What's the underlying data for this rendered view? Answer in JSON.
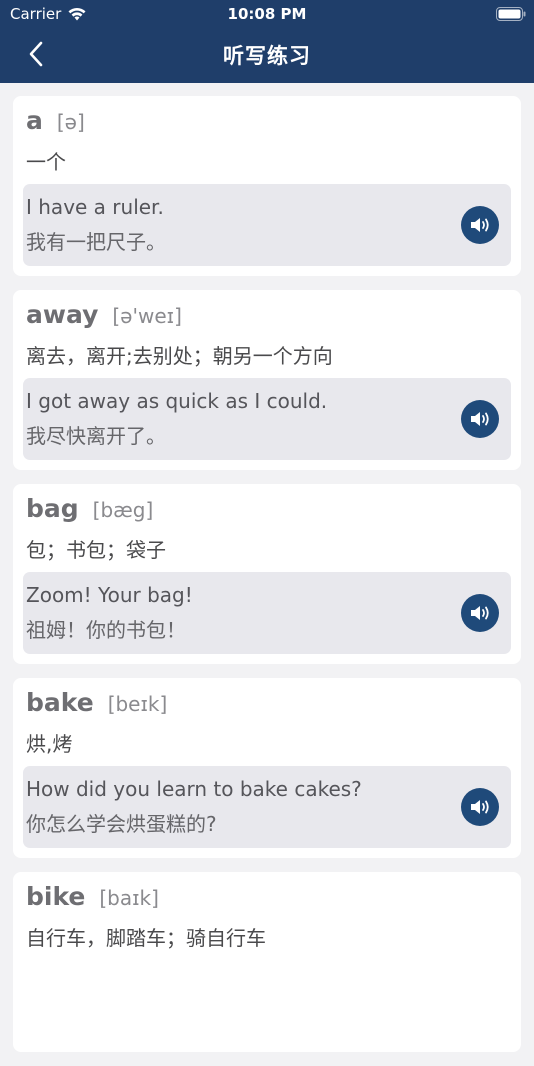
{
  "status_bar": {
    "carrier": "Carrier",
    "time": "10:08 PM"
  },
  "nav": {
    "title": "听写练习",
    "back_icon": "chevron-left-icon"
  },
  "colors": {
    "header_bg": "#1f3e6a",
    "speaker_bg": "#1f4a7a",
    "card_bg": "#ffffff",
    "example_bg": "#e8e8ed"
  },
  "cards": [
    {
      "word": "a",
      "phonetic": "[ə]",
      "meaning": "一个",
      "example_en": "I have a ruler.",
      "example_zh": "我有一把尺子。"
    },
    {
      "word": "away",
      "phonetic": "[ə'weɪ]",
      "meaning": "离去，离开;去别处；朝另一个方向",
      "example_en": "I got away as quick as I could.",
      "example_zh": "我尽快离开了。"
    },
    {
      "word": "bag",
      "phonetic": "[bæg]",
      "meaning": "包；书包；袋子",
      "example_en": "Zoom! Your bag!",
      "example_zh": "祖姆！你的书包！"
    },
    {
      "word": "bake",
      "phonetic": "[beɪk]",
      "meaning": "烘,烤",
      "example_en": "How did you learn to bake cakes?",
      "example_zh": "你怎么学会烘蛋糕的?"
    },
    {
      "word": "bike",
      "phonetic": "[baɪk]",
      "meaning": "自行车，脚踏车；骑自行车",
      "example_en": "",
      "example_zh": ""
    }
  ]
}
